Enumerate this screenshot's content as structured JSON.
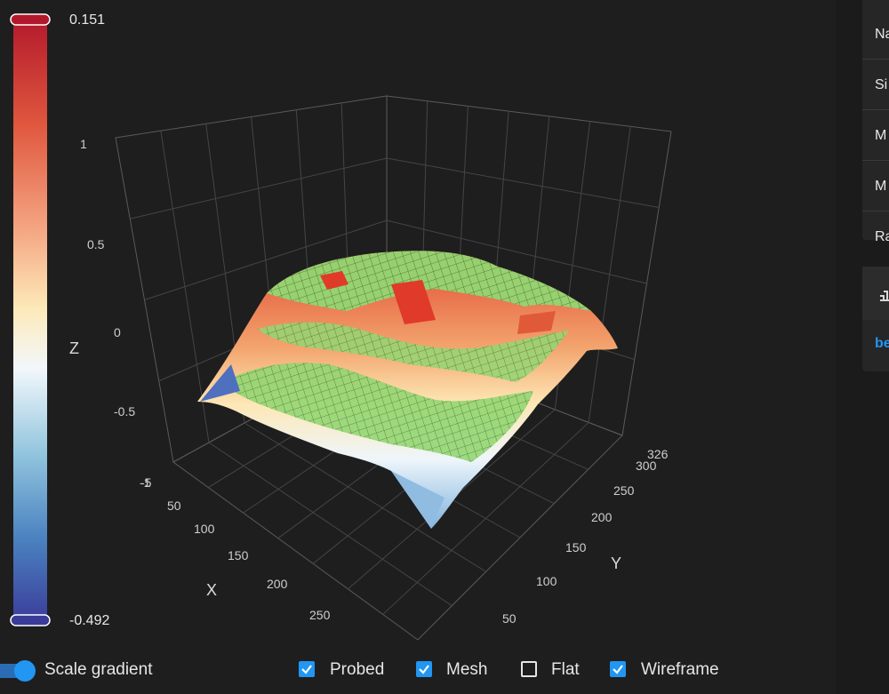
{
  "chart_data": {
    "type": "surface3d",
    "title": "",
    "xlabel": "X",
    "ylabel": "Y",
    "zlabel": "Z",
    "z_ticks": [
      "1",
      "0.5",
      "0",
      "-0.5",
      "-1"
    ],
    "x_ticks": [
      "-5",
      "50",
      "100",
      "150",
      "200",
      "250"
    ],
    "y_ticks": [
      "50",
      "100",
      "150",
      "200",
      "250",
      "300",
      "326"
    ],
    "zlim": [
      -1,
      1
    ],
    "grid": true,
    "colorscale_max": "0.151",
    "colorscale_min": "-0.492",
    "colorscale": [
      "#b2182b",
      "#ef8a62",
      "#fddbc7",
      "#f7f7f7",
      "#d1e5f0",
      "#67a9cf",
      "#2166ac",
      "#3b3b9a"
    ],
    "mesh_color": "#8fd16a",
    "surface_z": [
      [
        -0.35,
        -0.2,
        -0.1,
        -0.05,
        -0.08,
        -0.2,
        -0.45
      ],
      [
        -0.25,
        -0.05,
        0.05,
        0.08,
        0.05,
        -0.05,
        -0.3
      ],
      [
        -0.15,
        0.02,
        0.12,
        0.15,
        0.12,
        0.02,
        -0.2
      ],
      [
        -0.1,
        0.05,
        0.15,
        0.12,
        0.15,
        0.05,
        -0.15
      ],
      [
        -0.15,
        0.02,
        0.1,
        0.12,
        0.1,
        0.02,
        -0.2
      ],
      [
        -0.3,
        -0.1,
        0.0,
        0.05,
        0.0,
        -0.1,
        -0.35
      ],
      [
        -0.45,
        -0.25,
        -0.15,
        -0.1,
        -0.15,
        -0.3,
        -0.49
      ]
    ]
  },
  "side_panel": {
    "rows": [
      "Na",
      "Si",
      "M",
      "M",
      "Ra"
    ],
    "link": "be"
  },
  "controls": {
    "scale_gradient_label": "Scale gradient",
    "checkboxes": [
      {
        "label": "Probed",
        "checked": true
      },
      {
        "label": "Mesh",
        "checked": true
      },
      {
        "label": "Flat",
        "checked": false
      },
      {
        "label": "Wireframe",
        "checked": true
      }
    ]
  }
}
